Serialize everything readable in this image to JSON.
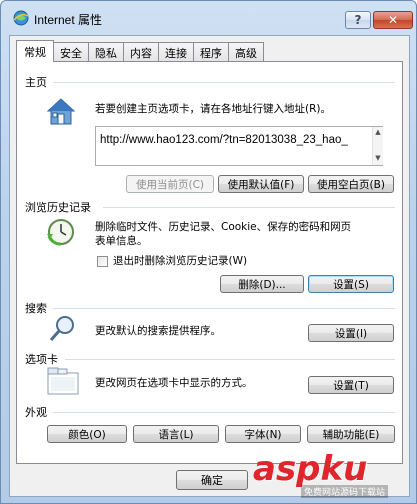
{
  "window": {
    "title": "Internet 属性",
    "help_label": "?",
    "close_label": "✕"
  },
  "tabs": [
    {
      "label": "常规",
      "active": true
    },
    {
      "label": "安全"
    },
    {
      "label": "隐私"
    },
    {
      "label": "内容"
    },
    {
      "label": "连接"
    },
    {
      "label": "程序"
    },
    {
      "label": "高级"
    }
  ],
  "homepage": {
    "title": "主页",
    "description": "若要创建主页选项卡，请在各地址行键入地址(R)。",
    "url": "http://www.hao123.com/?tn=82013038_23_hao_",
    "use_current": "使用当前页(C)",
    "use_default": "使用默认值(F)",
    "use_blank": "使用空白页(B)"
  },
  "history": {
    "title": "浏览历史记录",
    "description_line1": "删除临时文件、历史记录、Cookie、保存的密码和网页",
    "description_line2": "表单信息。",
    "checkbox_label": "退出时删除浏览历史记录(W)",
    "delete_button": "删除(D)...",
    "settings_button": "设置(S)"
  },
  "search": {
    "title": "搜索",
    "description": "更改默认的搜索提供程序。",
    "settings_button": "设置(I)"
  },
  "tabs_section": {
    "title": "选项卡",
    "description": "更改网页在选项卡中显示的方式。",
    "settings_button": "设置(T)"
  },
  "appearance": {
    "title": "外观",
    "colors": "颜色(O)",
    "languages": "语言(L)",
    "fonts": "字体(N)",
    "accessibility": "辅助功能(E)"
  },
  "footer": {
    "ok": "确定"
  },
  "watermark": {
    "logo": "aspku",
    "subtitle": "免费网站源码下载站"
  }
}
